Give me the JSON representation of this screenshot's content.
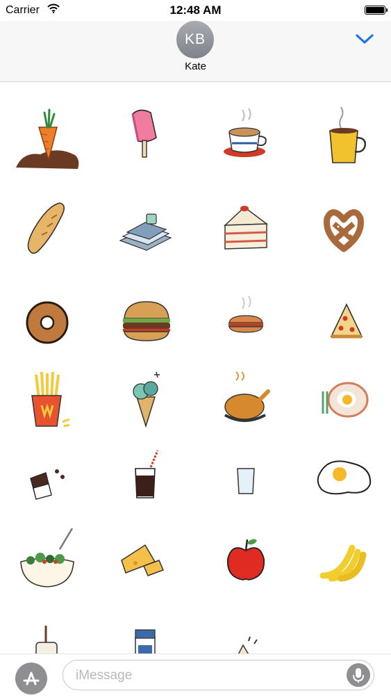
{
  "status_bar": {
    "carrier": "Carrier",
    "time": "12:48 AM"
  },
  "header": {
    "avatar_initials": "KB",
    "contact_name": "Kate"
  },
  "sticker_grid": [
    "carrier-sticker",
    "popsicle-sticker",
    "latte-cup-sticker",
    "coffee-mug-sticker",
    "baguette-sticker",
    "books-and-cup-sticker",
    "cake-slice-sticker",
    "pretzel-sticker",
    "donut-sticker",
    "burger-sticker",
    "hot-sandwich-sticker",
    "pizza-slice-sticker",
    "fries-sticker",
    "ice-cream-cone-sticker",
    "roast-chicken-sticker",
    "egg-plate-sticker",
    "chocolate-sticker",
    "soda-glass-sticker",
    "water-glass-sticker",
    "fried-egg-sticker",
    "salad-bowl-sticker",
    "cheese-sticker",
    "apple-sticker",
    "banana-sticker",
    "jar-sticker",
    "milk-carton-sticker",
    "sandwich-sticker",
    "fish-sticker"
  ],
  "input_bar": {
    "placeholder": "iMessage"
  },
  "colors": {
    "accent": "#1a73e8",
    "avatar": "#8e9097",
    "field_border": "#c7c7cc"
  },
  "icons": [
    "wifi-icon",
    "battery-icon",
    "chevron-down-icon",
    "app-store-icon",
    "microphone-icon"
  ]
}
